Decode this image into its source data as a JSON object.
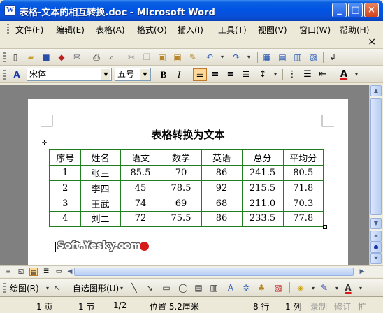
{
  "window": {
    "title": "表格-文本的相互转换.doc - Microsoft Word"
  },
  "menu": {
    "items": [
      "文件(F)",
      "编辑(E)",
      "表格(A)",
      "格式(O)",
      "插入(I)",
      "工具(T)",
      "视图(V)",
      "窗口(W)",
      "帮助(H)"
    ],
    "close_glyph": "×"
  },
  "format": {
    "font": "宋体",
    "size": "五号",
    "bold": "B",
    "italic": "I",
    "color_letter": "A"
  },
  "document": {
    "title": "表格转换为文本",
    "table": {
      "headers": [
        "序号",
        "姓名",
        "语文",
        "数学",
        "英语",
        "总分",
        "平均分"
      ],
      "rows": [
        [
          "1",
          "张三",
          "85.5",
          "70",
          "86",
          "241.5",
          "80.5"
        ],
        [
          "2",
          "李四",
          "45",
          "78.5",
          "92",
          "215.5",
          "71.8"
        ],
        [
          "3",
          "王武",
          "74",
          "69",
          "68",
          "211.0",
          "70.3"
        ],
        [
          "4",
          "刘二",
          "72",
          "75.5",
          "86",
          "233.5",
          "77.8"
        ]
      ]
    },
    "watermark": "Soft.Yesky.com"
  },
  "drawing": {
    "draw_label": "绘图(R)",
    "autoshape_label": "自选图形(U)"
  },
  "status": {
    "page": "1 页",
    "section": "1 节",
    "pages": "1/2",
    "position": "位置 5.2厘米",
    "line": "8 行",
    "column": "1 列",
    "rec": "录制",
    "trk": "修订",
    "ext": "扩"
  },
  "colors": {
    "title_bar": "#0054e3",
    "table_border": "#208020",
    "chrome": "#ece9d8",
    "active_button": "#ffd89a"
  }
}
